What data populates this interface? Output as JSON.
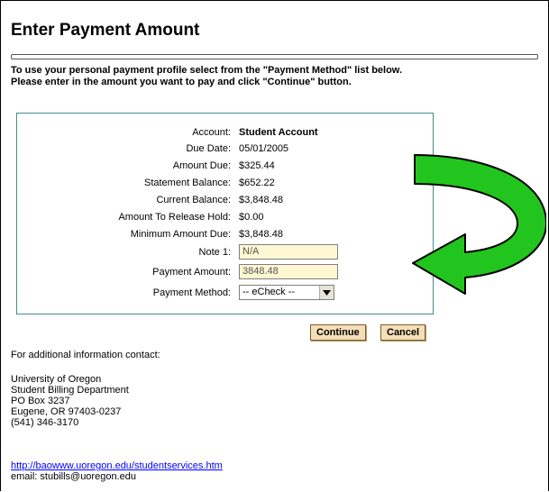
{
  "page_title": "Enter Payment Amount",
  "instructions": {
    "line1": "To use your personal payment profile select from the \"Payment Method\" list below.",
    "line2": "Please enter in the amount you want to pay and click \"Continue\" button."
  },
  "fields": {
    "account_label": "Account:",
    "account_value": "Student Account",
    "due_date_label": "Due Date:",
    "due_date_value": "05/01/2005",
    "amount_due_label": "Amount Due:",
    "amount_due_value": "$325.44",
    "statement_balance_label": "Statement Balance:",
    "statement_balance_value": "$652.22",
    "current_balance_label": "Current Balance:",
    "current_balance_value": "$3,848.48",
    "release_hold_label": "Amount To Release Hold:",
    "release_hold_value": "$0.00",
    "minimum_due_label": "Minimum Amount Due:",
    "minimum_due_value": "$3,848.48",
    "note1_label": "Note 1:",
    "note1_value": "N/A",
    "payment_amount_label": "Payment Amount:",
    "payment_amount_value": "3848.48",
    "payment_method_label": "Payment Method:",
    "payment_method_value": "-- eCheck --"
  },
  "buttons": {
    "continue": "Continue",
    "cancel": "Cancel"
  },
  "contact": {
    "heading": "For additional information contact:",
    "line1": "University of Oregon",
    "line2": "Student Billing Department",
    "line3": "PO Box 3237",
    "line4": "Eugene, OR 97403-0237",
    "line5": "(541) 346-3170",
    "link": "http://baowww.uoregon.edu/studentservices.htm",
    "email": "email: stubills@uoregon.edu"
  },
  "colors": {
    "panel_border": "#3f8f86",
    "button_bg": "#f4deb8",
    "input_bg": "#fdf8d2",
    "arrow_green": "#22c51d",
    "link": "#0000ff"
  },
  "icons": {
    "annotation_arrow": "curved-green-arrow-icon",
    "dropdown": "dropdown-arrow-icon"
  }
}
